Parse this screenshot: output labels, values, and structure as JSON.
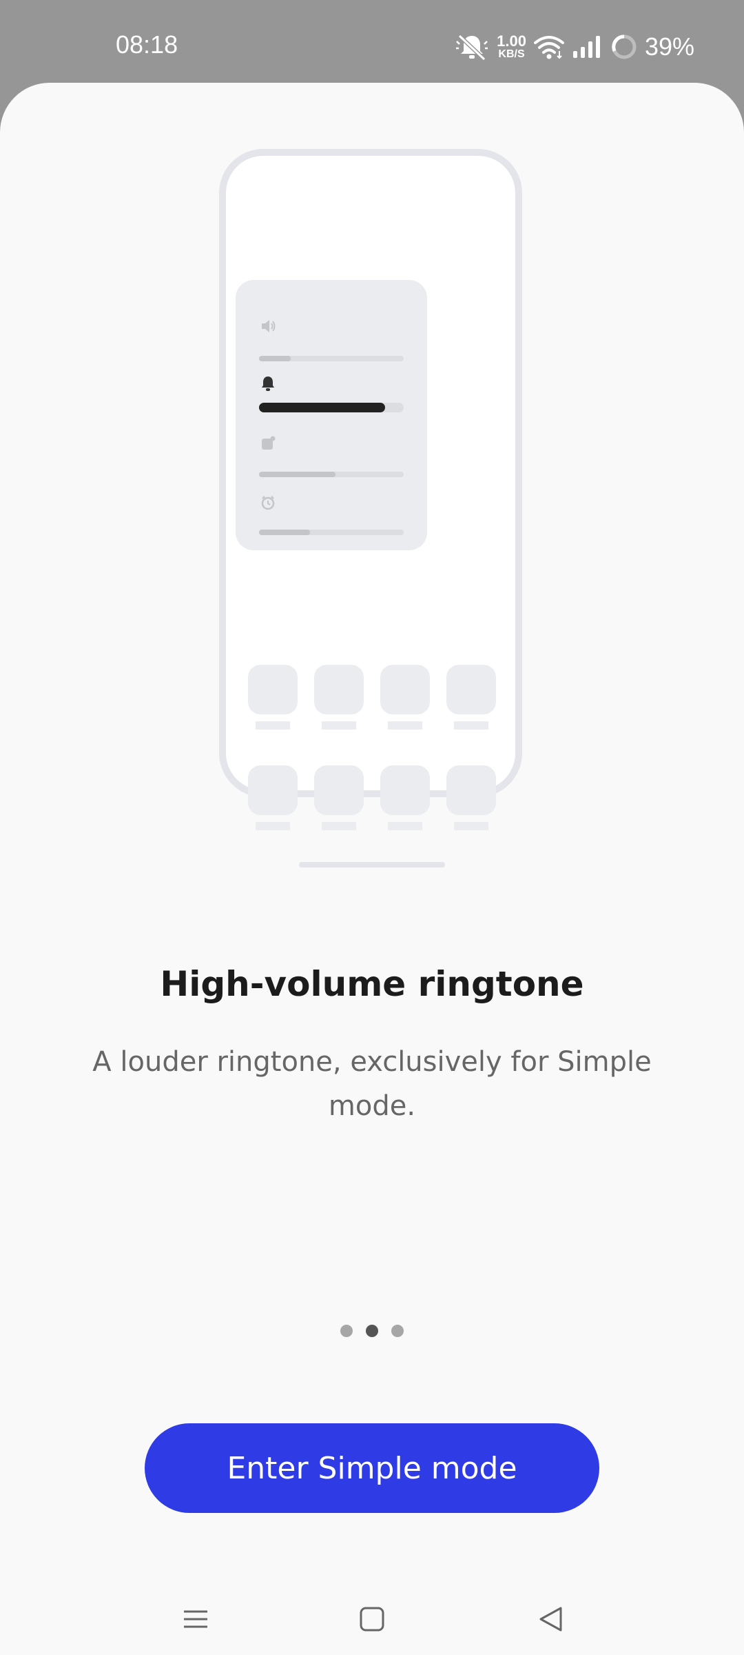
{
  "status_bar": {
    "time": "08:18",
    "network_speed_value": "1.00",
    "network_speed_unit": "KB/S",
    "battery_percent": "39%",
    "icons": [
      "mute-bell-icon",
      "wifi-icon",
      "signal-icon",
      "battery-ring-icon"
    ]
  },
  "illustration": {
    "volume_levels": {
      "media": 0.22,
      "ringtone": 0.87,
      "notification": 0.53,
      "alarm": 0.35
    },
    "icons": [
      "speaker-icon",
      "bell-icon",
      "notification-icon",
      "alarm-clock-icon"
    ]
  },
  "content": {
    "title": "High-volume ringtone",
    "description": "A louder ringtone, exclusively for Simple mode."
  },
  "pager": {
    "total": 3,
    "active_index": 1
  },
  "actions": {
    "primary_label": "Enter Simple mode"
  },
  "nav_bar": {
    "icons": [
      "menu-icon",
      "home-icon",
      "back-icon"
    ]
  },
  "colors": {
    "accent": "#2f3ce6",
    "sheet_background": "#f9f9f9",
    "status_background": "#969696"
  }
}
